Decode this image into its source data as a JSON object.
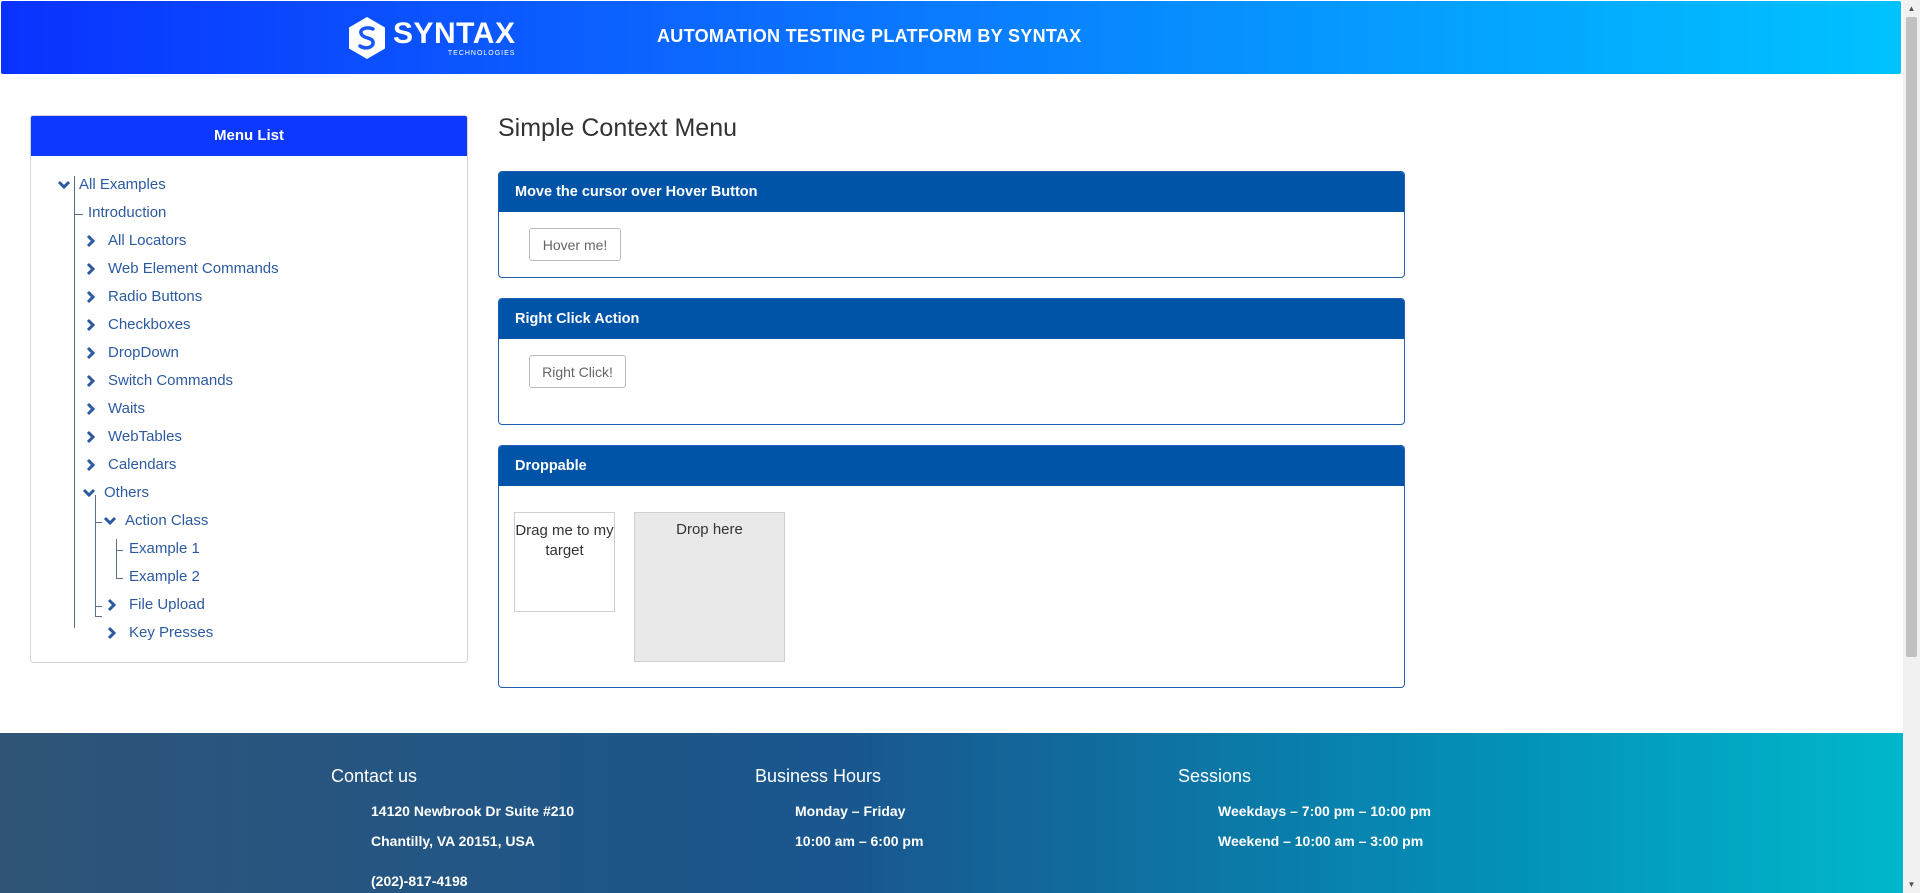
{
  "header": {
    "logo_text": "SYNTAX",
    "logo_subtext": "TECHNOLOGIES",
    "title": "AUTOMATION TESTING PLATFORM BY SYNTAX"
  },
  "menu": {
    "title": "Menu List",
    "items": [
      {
        "label": "All Examples",
        "state": "expanded"
      },
      {
        "label": "Introduction",
        "state": "leaf"
      },
      {
        "label": "All Locators",
        "state": "collapsed"
      },
      {
        "label": "Web Element Commands",
        "state": "collapsed"
      },
      {
        "label": "Radio Buttons",
        "state": "collapsed"
      },
      {
        "label": "Checkboxes",
        "state": "collapsed"
      },
      {
        "label": "DropDown",
        "state": "collapsed"
      },
      {
        "label": "Switch Commands",
        "state": "collapsed"
      },
      {
        "label": "Waits",
        "state": "collapsed"
      },
      {
        "label": "WebTables",
        "state": "collapsed"
      },
      {
        "label": "Calendars",
        "state": "collapsed"
      },
      {
        "label": "Others",
        "state": "expanded"
      },
      {
        "label": "Action Class",
        "state": "expanded"
      },
      {
        "label": "Example 1",
        "state": "leaf"
      },
      {
        "label": "Example 2",
        "state": "leaf"
      },
      {
        "label": "File Upload",
        "state": "collapsed"
      },
      {
        "label": "Key Presses",
        "state": "collapsed"
      }
    ]
  },
  "main": {
    "title": "Simple Context Menu",
    "hover_card": {
      "heading": "Move the cursor over Hover Button",
      "button_label": "Hover me!"
    },
    "right_click_card": {
      "heading": "Right Click Action",
      "button_label": "Right Click!"
    },
    "droppable_card": {
      "heading": "Droppable",
      "drag_label": "Drag me to my target",
      "drop_label": "Drop here"
    }
  },
  "footer": {
    "contact": {
      "title": "Contact us",
      "address1": "14120 Newbrook Dr Suite #210",
      "address2": "Chantilly, VA 20151, USA",
      "phone": "(202)-817-4198"
    },
    "hours": {
      "title": "Business Hours",
      "days": "Monday – Friday",
      "time": "10:00 am – 6:00 pm"
    },
    "sessions": {
      "title": "Sessions",
      "weekdays": "Weekdays – 7:00 pm – 10:00 pm",
      "weekend": "Weekend – 10:00 am – 3:00 pm"
    }
  },
  "colors": {
    "header_gradient_start": "#0a32ff",
    "header_gradient_end": "#00c3ff",
    "menu_head": "#0d38ff",
    "card_head": "#0054a8",
    "link": "#2c5aa0"
  }
}
